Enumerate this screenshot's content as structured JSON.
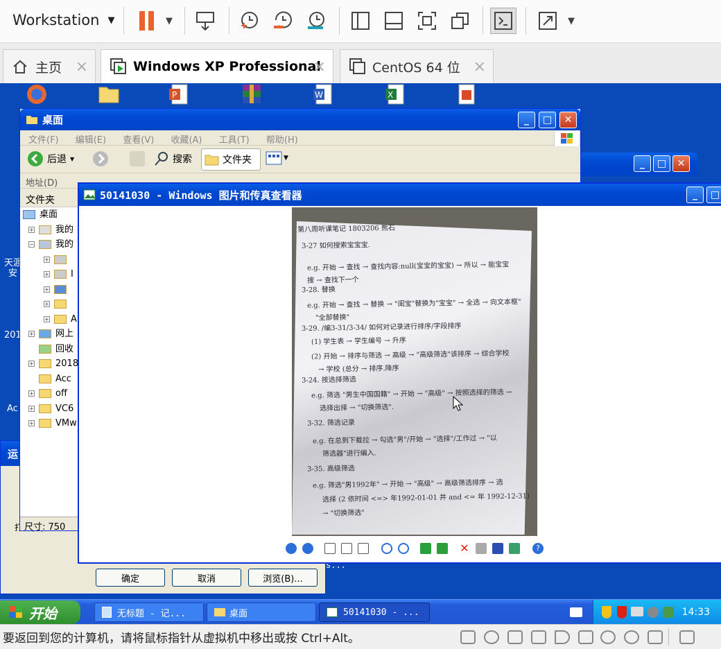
{
  "vm_toolbar": {
    "title": "Workstation"
  },
  "vm_tabs": [
    {
      "label": "主页"
    },
    {
      "label": "Windows XP Professional"
    },
    {
      "label": "CentOS 64 位"
    }
  ],
  "explorer": {
    "title": "桌面",
    "menu": [
      "文件(F)",
      "编辑(E)",
      "查看(V)",
      "收藏(A)",
      "工具(T)",
      "帮助(H)"
    ],
    "back": "后退",
    "search": "搜索",
    "folders": "文件夹",
    "address_label": "地址(D)",
    "folders_header": "文件夹",
    "status": "尺寸: 750",
    "tree": [
      {
        "label": "桌面"
      },
      {
        "label": "我的"
      },
      {
        "label": "我的"
      },
      {
        "label": ""
      },
      {
        "label": "I"
      },
      {
        "label": ""
      },
      {
        "label": ""
      },
      {
        "label": "A"
      },
      {
        "label": "网上"
      },
      {
        "label": "回收"
      },
      {
        "label": "2018"
      },
      {
        "label": "Acc"
      },
      {
        "label": "off"
      },
      {
        "label": "VC6"
      },
      {
        "label": "VMw"
      }
    ]
  },
  "viewer": {
    "title": "50141030 - Windows 图片和传真查看器",
    "note_lines": [
      "第八周听课笔记  1803206  熊石",
      "3-27  如何搜索宝宝宝.",
      "e.g. 开始 → 查找 → 查找内容:null(宝宝的宝宝) → 所以 → 能宝宝",
      "搜 → 查找下一个",
      "3-28. 替换",
      "e.g. 开始 → 查找 → 替换 → \"闺宝\"替换为\"宝宝\" → 全选 → 向文本框\"",
      "\"全部替换\"",
      "3-29. /编3-31/3-34/ 如何对记录进行排序/字段排序",
      "(1) 学生表 → 学生编号 → 升序",
      "(2) 开始 → 排序与筛选 → 高级 → \"高级筛选\"该排序 → 综合学校",
      "→ 学校 (总分 → 排序.降序",
      "3-24. 按选择筛选",
      "e.g. 筛选 \"男生中国国籍\" → 开始 → \"高级\" → 按照选择的筛选 →",
      "选择出择 → \"切换筛选\".",
      "3-32. 筛选记录",
      "e.g. 在总到下载拉 → 勾选\"男\"/开始 → \"选择\"/工作过 → \"以",
      "筛选器\"进行编入.",
      "3-35. 高级筛选",
      "e.g. 筛选\"男1992年\" → 开始 → \"高级\" → 高级筛选排序 → 选",
      "选择 (2 依时间 <=> 年1992-01-01 并 and <= 年 1992-12-31)",
      "→ \"切换筛选\""
    ]
  },
  "dialog": {
    "title": "运",
    "ok": "确定",
    "cancel": "取消",
    "browse": "浏览(B)...",
    "open_label": "打开(O):"
  },
  "desktop_side": {
    "texts": [
      "天涯",
      "安",
      "201",
      "Ac"
    ]
  },
  "taskbar": {
    "start": "开始",
    "items": [
      "无标题 - 记...",
      "桌面",
      "50141030 - ..."
    ],
    "time": "14:33"
  },
  "status_bar": {
    "message": "要返回到您的计算机，请将鼠标指针从虚拟机中移出或按 Ctrl+Alt。"
  },
  "behind_text": "s..."
}
